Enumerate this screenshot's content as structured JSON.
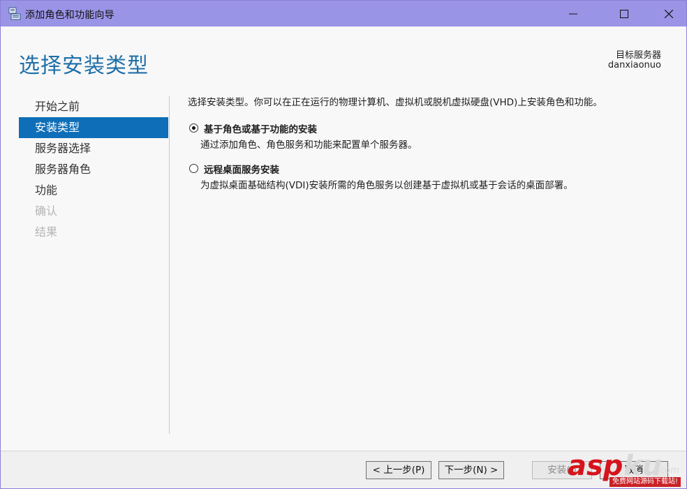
{
  "window": {
    "title": "添加角色和功能向导",
    "icon": "server-manager-icon",
    "controls": {
      "minimize": "minimize-icon",
      "maximize": "maximize-icon",
      "close": "close-icon"
    }
  },
  "header": {
    "page_title": "选择安装类型",
    "target_label": "目标服务器",
    "target_value": "danxiaonuo"
  },
  "nav": {
    "items": [
      {
        "label": "开始之前",
        "state": "normal"
      },
      {
        "label": "安装类型",
        "state": "active"
      },
      {
        "label": "服务器选择",
        "state": "normal"
      },
      {
        "label": "服务器角色",
        "state": "normal"
      },
      {
        "label": "功能",
        "state": "normal"
      },
      {
        "label": "确认",
        "state": "disabled"
      },
      {
        "label": "结果",
        "state": "disabled"
      }
    ]
  },
  "content": {
    "intro": "选择安装类型。你可以在正在运行的物理计算机、虚拟机或脱机虚拟硬盘(VHD)上安装角色和功能。",
    "options": [
      {
        "title": "基于角色或基于功能的安装",
        "description": "通过添加角色、角色服务和功能来配置单个服务器。",
        "selected": true
      },
      {
        "title": "远程桌面服务安装",
        "description": "为虚拟桌面基础结构(VDI)安装所需的角色服务以创建基于虚拟机或基于会话的桌面部署。",
        "selected": false
      }
    ]
  },
  "footer": {
    "prev_label": "< 上一步(P)",
    "next_label": "下一步(N) >",
    "install_label": "安装(I)",
    "cancel_label": "取消"
  },
  "watermark": {
    "brand_red": "asp",
    "brand_gray": "ku",
    "domain_suffix": ".com",
    "tagline": "免费网站源码下载站!"
  },
  "colors": {
    "titlebar": "#9a94e6",
    "accent": "#0e6eb8",
    "page_title": "#1e6fa8"
  }
}
